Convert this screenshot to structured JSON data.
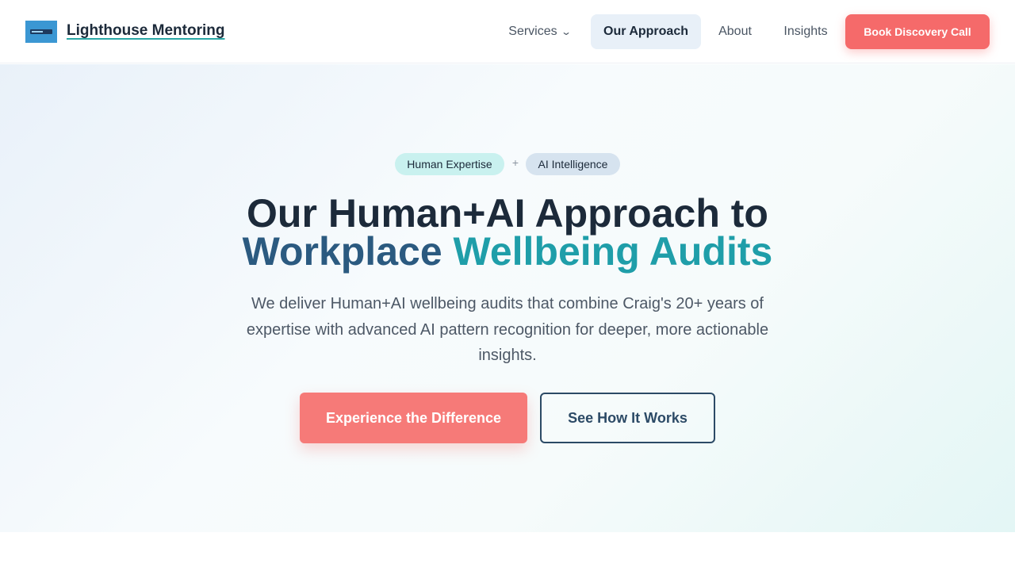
{
  "header": {
    "brand": "Lighthouse Mentoring",
    "nav": {
      "services": "Services",
      "approach": "Our Approach",
      "about": "About",
      "insights": "Insights"
    },
    "cta": "Book Discovery Call"
  },
  "hero": {
    "pill_human": "Human Expertise",
    "pill_plus": "+",
    "pill_ai": "AI Intelligence",
    "title_line1": "Our Human+AI Approach to",
    "title_line2_part1": "Workplace ",
    "title_line2_part2": "Wellbeing Audits",
    "description": "We deliver Human+AI wellbeing audits that combine Craig's 20+ years of expertise with advanced AI pattern recognition for deeper, more actionable insights.",
    "primary_button": "Experience the Difference",
    "secondary_button": "See How It Works"
  },
  "icons": {
    "services_chevron": "chevron-down-icon"
  },
  "colors": {
    "accent_coral": "#f56a6a",
    "teal": "#1f9ea9",
    "navy": "#2b5a80",
    "dark_text": "#1c2a3a"
  }
}
